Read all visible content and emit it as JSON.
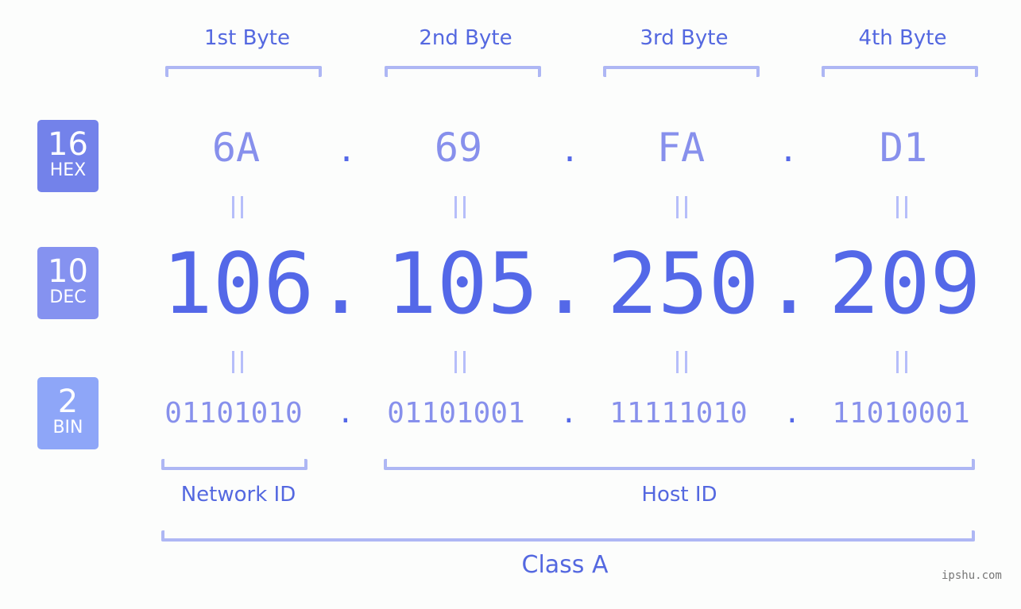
{
  "bytes": {
    "labels": [
      "1st Byte",
      "2nd Byte",
      "3rd Byte",
      "4th Byte"
    ]
  },
  "bases": {
    "hex": {
      "number": "16",
      "label": "HEX",
      "color": "#7382ea"
    },
    "dec": {
      "number": "10",
      "label": "DEC",
      "color": "#8592f0"
    },
    "bin": {
      "number": "2",
      "label": "BIN",
      "color": "#8ea6f8"
    }
  },
  "ip": {
    "hex": [
      "6A",
      "69",
      "FA",
      "D1"
    ],
    "dec": [
      "106",
      "105",
      "250",
      "209"
    ],
    "bin": [
      "01101010",
      "01101001",
      "11111010",
      "11010001"
    ],
    "separator": ".",
    "equals": "="
  },
  "parts": {
    "network": "Network ID",
    "host": "Host ID",
    "class": "Class A"
  },
  "watermark": "ipshu.com",
  "colors": {
    "accent": "#5468e8",
    "light_value": "#8790ec",
    "bracket": "#aeb7f4"
  }
}
